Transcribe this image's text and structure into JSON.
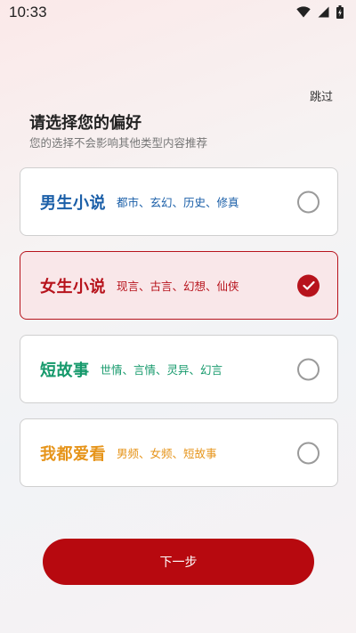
{
  "status": {
    "time": "10:33"
  },
  "header": {
    "skip_label": "跳过",
    "title": "请选择您的偏好",
    "subtitle": "您的选择不会影响其他类型内容推荐"
  },
  "options": [
    {
      "name": "男生小说",
      "tags": "都市、玄幻、历史、修真",
      "color": "#1b5fa8",
      "selected": false
    },
    {
      "name": "女生小说",
      "tags": "现言、古言、幻想、仙侠",
      "color": "#b7131c",
      "selected": true
    },
    {
      "name": "短故事",
      "tags": "世情、言情、灵异、幻言",
      "color": "#15996b",
      "selected": false
    },
    {
      "name": "我都爱看",
      "tags": "男频、女频、短故事",
      "color": "#e6941a",
      "selected": false
    }
  ],
  "footer": {
    "next_label": "下一步"
  },
  "theme": {
    "accent": "#b7090f"
  }
}
